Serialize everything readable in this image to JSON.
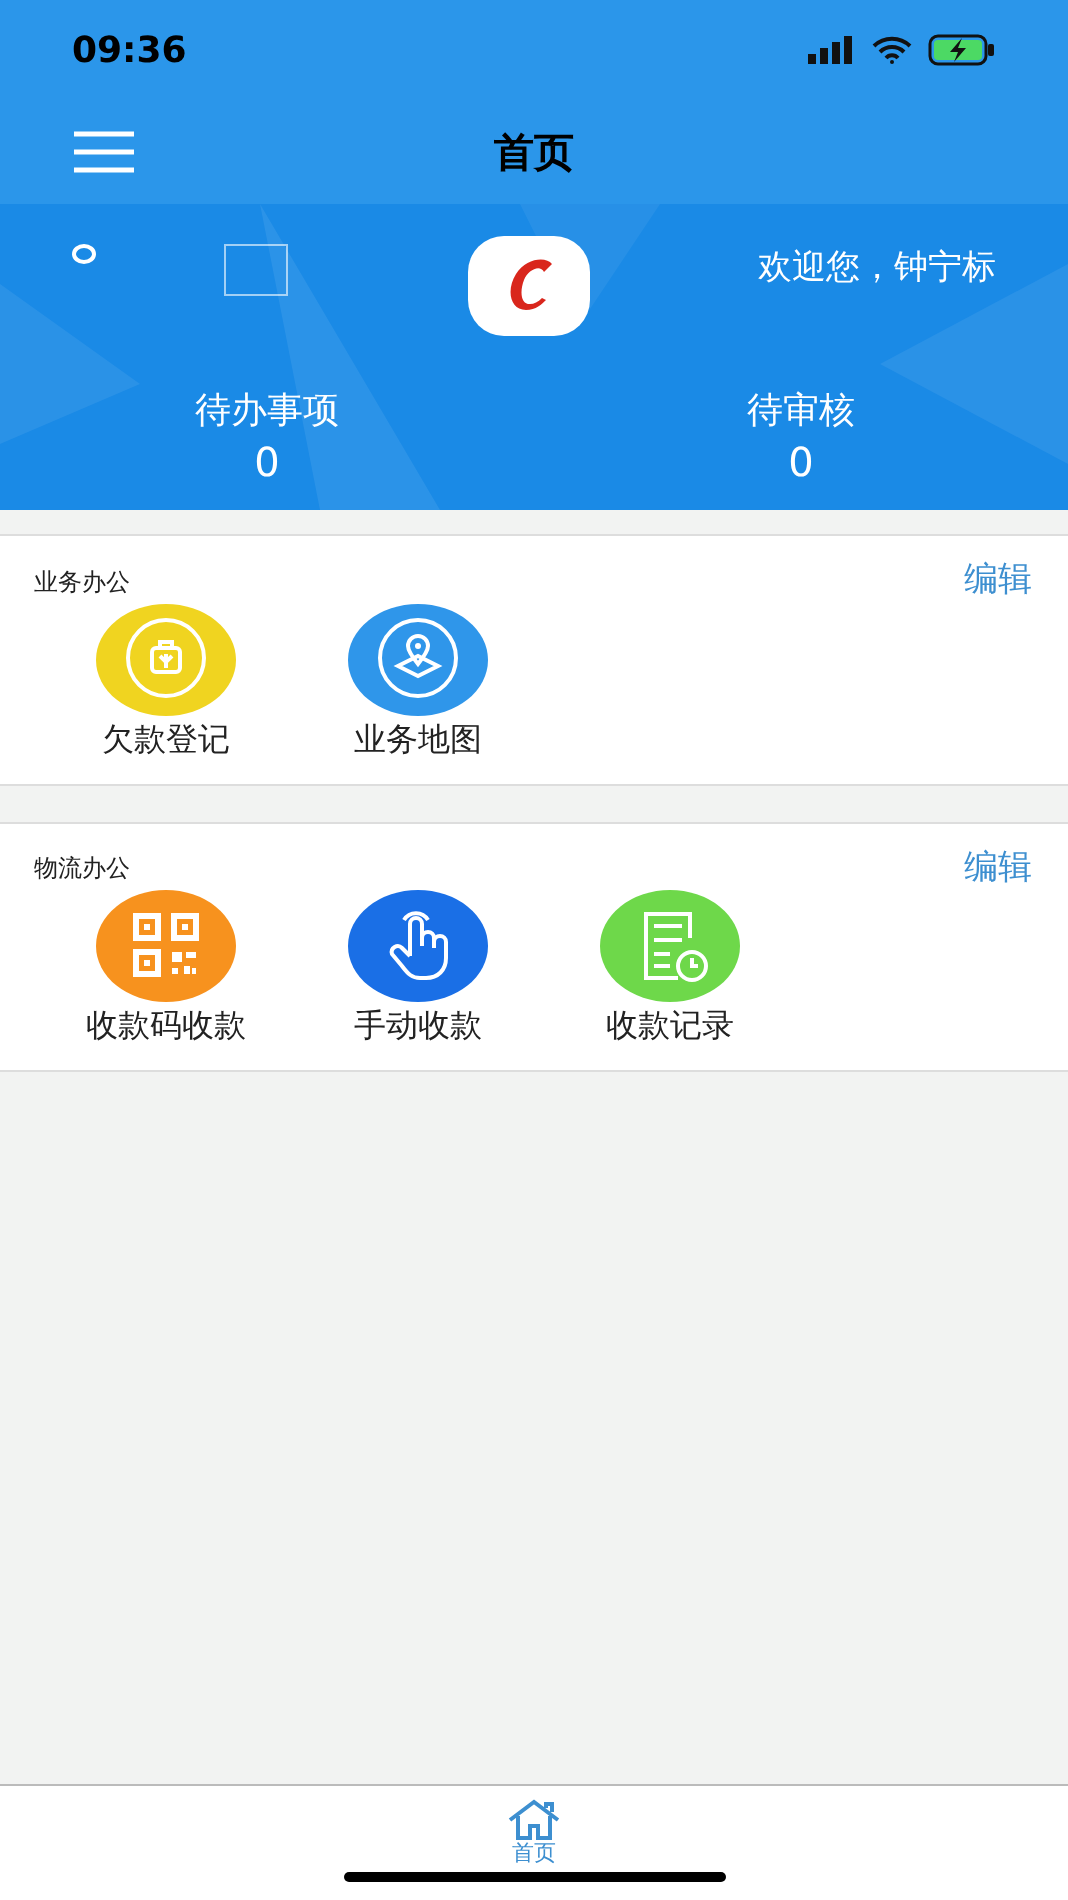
{
  "status_bar": {
    "time": "09:36"
  },
  "nav_bar": {
    "title": "首页"
  },
  "header": {
    "greeting": "欢迎您，钟宁标",
    "stats": [
      {
        "label": "待办事项",
        "value": "0"
      },
      {
        "label": "待审核",
        "value": "0"
      }
    ]
  },
  "sections": [
    {
      "title": "业务办公",
      "action": "编辑",
      "items": [
        {
          "label": "欠款登记",
          "kind": "bag",
          "color": "#f0d420"
        },
        {
          "label": "业务地图",
          "kind": "map",
          "color": "#2f96ea"
        }
      ]
    },
    {
      "title": "物流办公",
      "action": "编辑",
      "items": [
        {
          "label": "收款码收款",
          "kind": "qr",
          "color": "#f7921e"
        },
        {
          "label": "手动收款",
          "kind": "hand",
          "color": "#1a6fe6"
        },
        {
          "label": "收款记录",
          "kind": "record",
          "color": "#6ed84a"
        }
      ]
    }
  ],
  "tab_bar": {
    "tabs": [
      {
        "label": "首页",
        "selected": true
      }
    ]
  }
}
